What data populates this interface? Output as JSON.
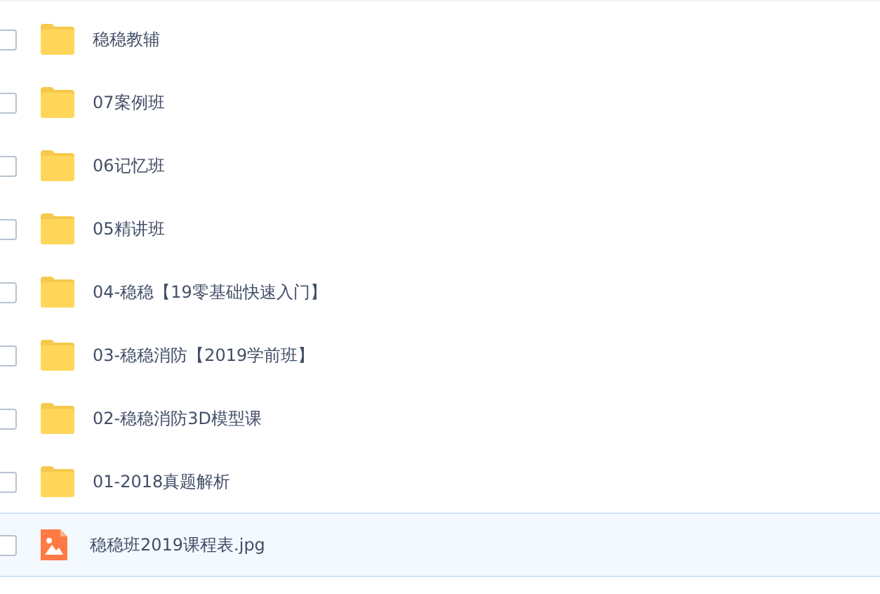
{
  "files": [
    {
      "name": "稳稳教辅",
      "kind": "folder",
      "selected": false
    },
    {
      "name": "07案例班",
      "kind": "folder",
      "selected": false
    },
    {
      "name": "06记忆班",
      "kind": "folder",
      "selected": false
    },
    {
      "name": "05精讲班",
      "kind": "folder",
      "selected": false
    },
    {
      "name": "04-稳稳【19零基础快速入门】",
      "kind": "folder",
      "selected": false
    },
    {
      "name": "03-稳稳消防【2019学前班】",
      "kind": "folder",
      "selected": false
    },
    {
      "name": "02-稳稳消防3D模型课",
      "kind": "folder",
      "selected": false
    },
    {
      "name": "01-2018真题解析",
      "kind": "folder",
      "selected": false
    },
    {
      "name": "稳稳班2019课程表.jpg",
      "kind": "image",
      "selected": true
    }
  ]
}
